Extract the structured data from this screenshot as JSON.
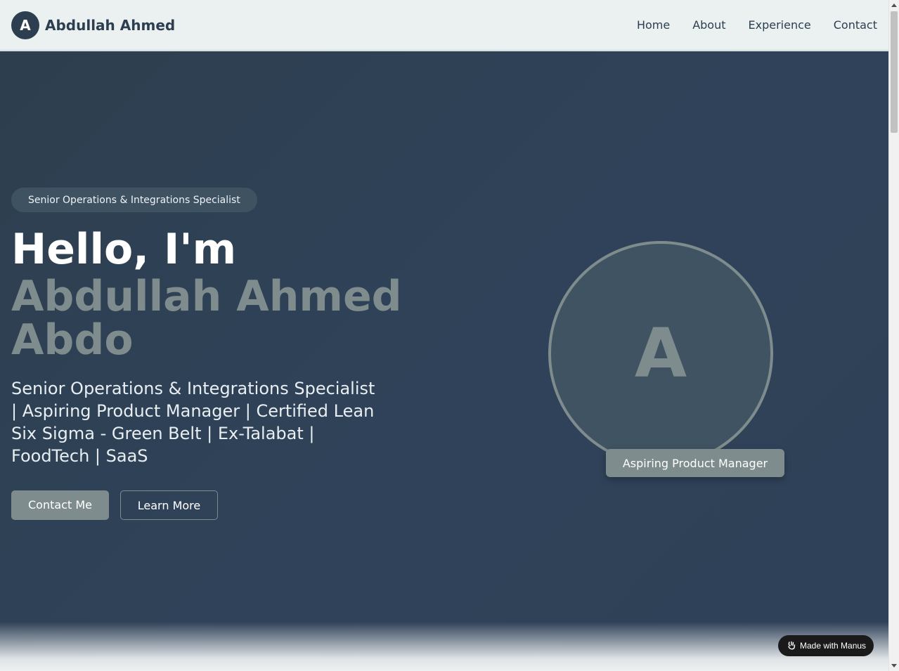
{
  "header": {
    "avatar_letter": "A",
    "brand_name": "Abdullah Ahmed",
    "nav": [
      "Home",
      "About",
      "Experience",
      "Contact"
    ]
  },
  "hero": {
    "badge": "Senior Operations & Integrations Specialist",
    "greeting": "Hello, I'm",
    "name": "Abdullah Ahmed Abdo",
    "tagline": "Senior Operations & Integrations Specialist | Aspiring Product Manager | Certified Lean Six Sigma - Green Belt | Ex-Talabat | FoodTech | SaaS",
    "primary_button": "Contact Me",
    "secondary_button": "Learn More",
    "profile_letter": "A",
    "role_badge": "Aspiring Product Manager"
  },
  "footer_badge": {
    "label": "Made with Manus",
    "icon": "manus-icon"
  },
  "colors": {
    "primary_dark": "#2c3e50",
    "accent_gray": "#7f8c8d",
    "header_bg": "#ebf0f1"
  }
}
